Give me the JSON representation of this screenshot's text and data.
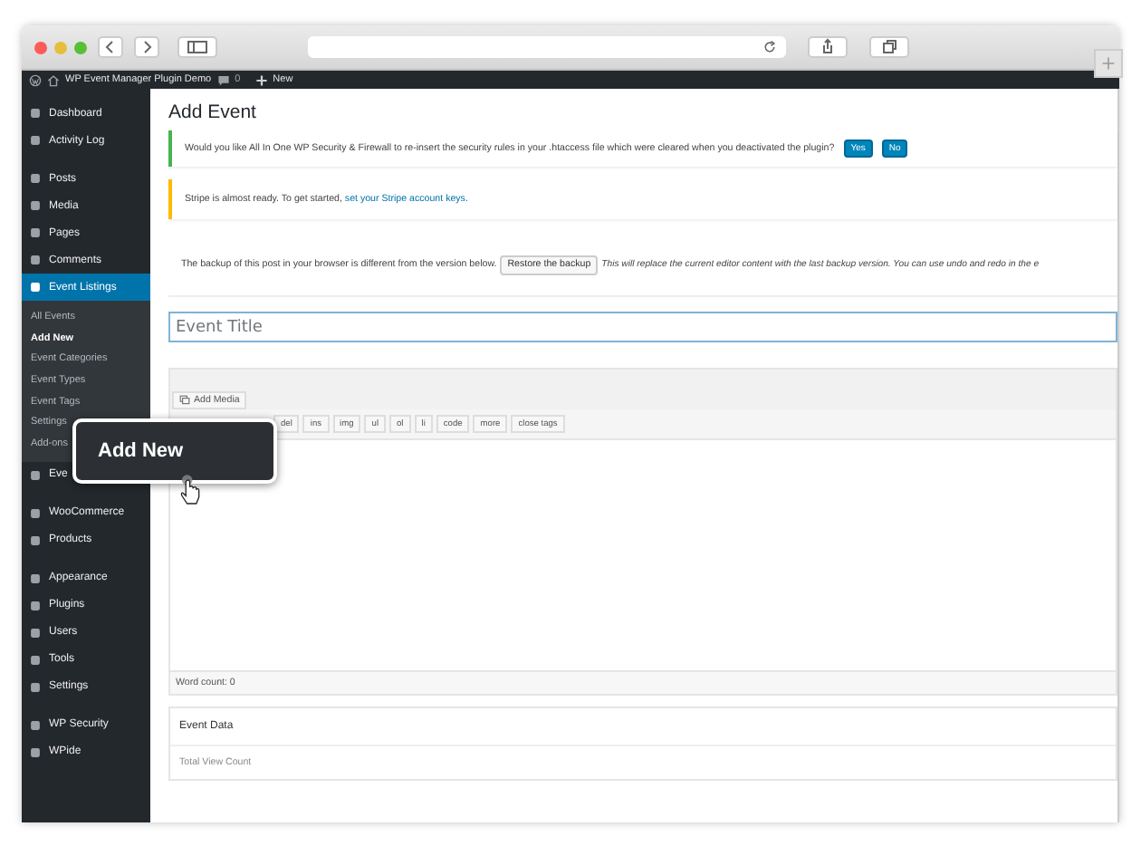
{
  "admin_bar": {
    "site": "WP Event Manager Plugin Demo",
    "comments": "0",
    "new": "New"
  },
  "sidebar": {
    "groups": [
      {
        "items": [
          {
            "label": "Dashboard",
            "selected": false
          },
          {
            "label": "Activity Log",
            "selected": false
          }
        ]
      },
      {
        "items": [
          {
            "label": "Posts",
            "selected": false
          },
          {
            "label": "Media",
            "selected": false
          },
          {
            "label": "Pages",
            "selected": false
          },
          {
            "label": "Comments",
            "selected": false
          },
          {
            "label": "Event Listings",
            "selected": true,
            "children": [
              {
                "label": "All Events",
                "selected": false
              },
              {
                "label": "Add New",
                "selected": true
              },
              {
                "label": "Event Categories",
                "selected": false
              },
              {
                "label": "Event Types",
                "selected": false
              },
              {
                "label": "Event Tags",
                "selected": false
              },
              {
                "label": "Settings",
                "selected": false
              },
              {
                "label": "Add-ons",
                "selected": false
              }
            ]
          },
          {
            "label": "Eve",
            "selected": false
          }
        ]
      },
      {
        "items": [
          {
            "label": "WooCommerce",
            "selected": false
          },
          {
            "label": "Products",
            "selected": false
          }
        ]
      },
      {
        "items": [
          {
            "label": "Appearance",
            "selected": false
          },
          {
            "label": "Plugins",
            "selected": false
          },
          {
            "label": "Users",
            "selected": false
          },
          {
            "label": "Tools",
            "selected": false
          },
          {
            "label": "Settings",
            "selected": false
          }
        ]
      },
      {
        "items": [
          {
            "label": "WP Security",
            "selected": false
          },
          {
            "label": "WPide",
            "selected": false
          }
        ]
      }
    ]
  },
  "tooltip": {
    "label": "Add New"
  },
  "page": {
    "title": "Add Event",
    "notices": [
      {
        "kind": "success",
        "text": "Would you like All In One WP Security & Firewall to re-insert the security rules in your .htaccess file which were cleared when you deactivated the plugin?",
        "buttons": [
          "Yes",
          "No"
        ]
      },
      {
        "kind": "warning",
        "text": "Stripe is almost ready. To get started, ",
        "link": "set your Stripe account keys."
      }
    ],
    "backup": {
      "text": "The backup of this post in your browser is different from the version below.",
      "button": "Restore the backup",
      "note": "This will replace the current editor content with the last backup version. You can use undo and redo in the e"
    },
    "title_placeholder": "Event Title",
    "add_media": "Add Media",
    "quicktags": [
      "del",
      "ins",
      "img",
      "ul",
      "ol",
      "li",
      "code",
      "more",
      "close tags"
    ],
    "word_count": "Word count: 0",
    "event_data": {
      "title": "Event Data",
      "field": "Total View Count"
    }
  }
}
